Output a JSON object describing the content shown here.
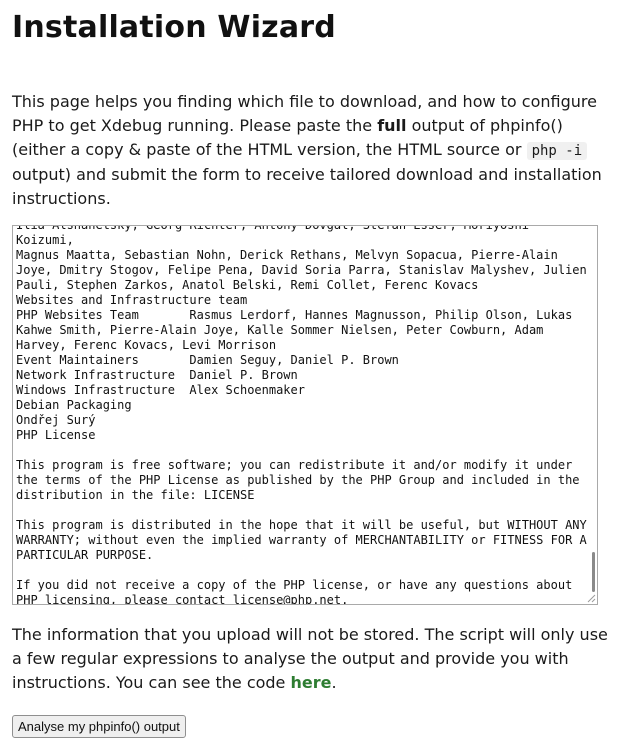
{
  "page": {
    "title": "Installation Wizard"
  },
  "intro": {
    "part1": "This page helps you finding which file to download, and how to configure PHP to get Xdebug running. Please paste the ",
    "bold": "full",
    "part2": " output of phpinfo() (either a copy & paste of the HTML version, the HTML source or ",
    "code": "php -i",
    "part3": " output) and submit the form to receive tailored download and installation instructions."
  },
  "textarea": {
    "content": "Ilia Alshanetsky, Georg Richter, Antony Dovgal, Stefan Esser, Moriyoshi Koizumi,\nMagnus Maatta, Sebastian Nohn, Derick Rethans, Melvyn Sopacua, Pierre-Alain\nJoye, Dmitry Stogov, Felipe Pena, David Soria Parra, Stanislav Malyshev, Julien\nPauli, Stephen Zarkos, Anatol Belski, Remi Collet, Ferenc Kovacs\nWebsites and Infrastructure team\nPHP Websites Team       Rasmus Lerdorf, Hannes Magnusson, Philip Olson, Lukas\nKahwe Smith, Pierre-Alain Joye, Kalle Sommer Nielsen, Peter Cowburn, Adam\nHarvey, Ferenc Kovacs, Levi Morrison\nEvent Maintainers       Damien Seguy, Daniel P. Brown\nNetwork Infrastructure  Daniel P. Brown\nWindows Infrastructure  Alex Schoenmaker\nDebian Packaging\nOndřej Surý\nPHP License\n\nThis program is free software; you can redistribute it and/or modify it under\nthe terms of the PHP License as published by the PHP Group and included in the\ndistribution in the file: LICENSE\n\nThis program is distributed in the hope that it will be useful, but WITHOUT ANY\nWARRANTY; without even the implied warranty of MERCHANTABILITY or FITNESS FOR A\nPARTICULAR PURPOSE.\n\nIf you did not receive a copy of the PHP license, or have any questions about\nPHP licensing, please contact license@php.net."
  },
  "note": {
    "text": "The information that you upload will not be stored. The script will only use a few regular expressions to analyse the output and provide you with instructions. You can see the code ",
    "link_label": "here",
    "end": "."
  },
  "form": {
    "submit_label": "Analyse my phpinfo() output"
  }
}
